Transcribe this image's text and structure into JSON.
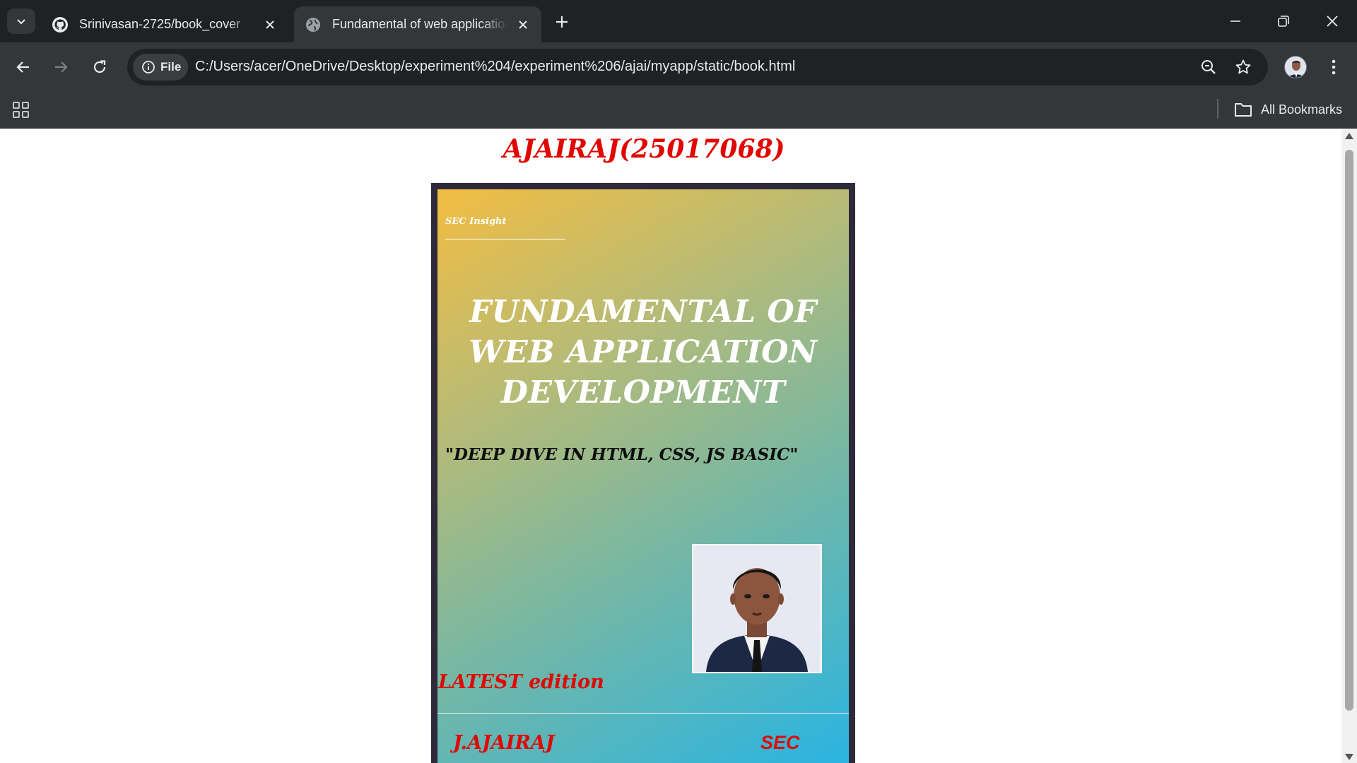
{
  "browser": {
    "tabs": [
      {
        "title": "Srinivasan-2725/book_cover",
        "favicon": "github-icon",
        "active": false
      },
      {
        "title": "Fundamental of web application",
        "favicon": "globe-icon",
        "active": true
      }
    ],
    "omnibox": {
      "chip_label": "File",
      "url": "C:/Users/acer/OneDrive/Desktop/experiment%204/experiment%206/ajai/myapp/static/book.html"
    },
    "bookmarks": {
      "all_bookmarks_label": "All Bookmarks"
    }
  },
  "page": {
    "heading": "AJAIRAJ(25017068)",
    "cover": {
      "publisher": "SEC Insight",
      "title_lines": [
        "FUNDAMENTAL OF",
        "WEB APPLICATION",
        "DEVELOPMENT"
      ],
      "subtitle": "\"DEEP DIVE IN HTML, CSS, JS BASIC\"",
      "edition": "LATEST edition",
      "author": "J.AJAIRAJ",
      "organization": "SEC",
      "colors": {
        "gradient_start": "#f2bd42",
        "gradient_end": "#22b4e8",
        "accent_red": "#e10600",
        "frame": "#2e2a3a"
      }
    }
  }
}
